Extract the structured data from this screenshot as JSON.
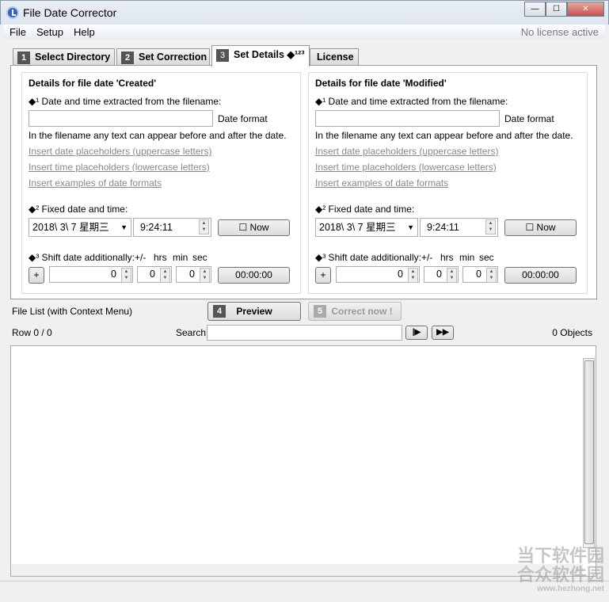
{
  "window": {
    "title": "File Date Corrector",
    "minimize": "—",
    "maximize": "☐",
    "close": "✕"
  },
  "menu": {
    "items": [
      "File",
      "Setup",
      "Help"
    ],
    "license_status": "No license active"
  },
  "tabs": [
    {
      "num": "1",
      "label": "Select Directory"
    },
    {
      "num": "2",
      "label": "Set Correction"
    },
    {
      "num": "3",
      "label": "Set Details ◆¹²³"
    },
    {
      "num": "",
      "label": "License"
    }
  ],
  "groups": [
    {
      "header": "Details for file date 'Created'",
      "extract_label": "◆¹ Date and time extracted from the filename:",
      "filename_value": "",
      "date_format_label": "Date format",
      "hint": "In the filename any text can appear before and after the date.",
      "link1": "Insert date placeholders (uppercase letters)",
      "link2": "Insert time placeholders (lowercase letters)",
      "link3": "Insert examples of date formats",
      "fixed_label": "◆² Fixed date and time:",
      "date_value": "2018\\  3\\  7 星期三",
      "time_value": "9:24:11",
      "now_label": "☐  Now",
      "shift_label": "◆³ Shift date additionally:",
      "col_sign": "+/-",
      "col_hrs": "hrs",
      "col_min": "min",
      "col_sec": "sec",
      "sign": "+",
      "hrs": "0",
      "min": "0",
      "sec": "0",
      "reset_label": "00:00:00"
    },
    {
      "header": "Details for file date 'Modified'",
      "extract_label": "◆¹ Date and time extracted from the filename:",
      "filename_value": "",
      "date_format_label": "Date format",
      "hint": "In the filename any text can appear before and after the date.",
      "link1": "Insert date placeholders (uppercase letters)",
      "link2": "Insert time placeholders (lowercase letters)",
      "link3": "Insert examples of date formats",
      "fixed_label": "◆² Fixed date and time:",
      "date_value": "2018\\  3\\  7 星期三",
      "time_value": "9:24:11",
      "now_label": "☐  Now",
      "shift_label": "◆³ Shift date additionally:",
      "col_sign": "+/-",
      "col_hrs": "hrs",
      "col_min": "min",
      "col_sec": "sec",
      "sign": "+",
      "hrs": "0",
      "min": "0",
      "sec": "0",
      "reset_label": "00:00:00"
    }
  ],
  "filelist": {
    "label": "File List (with Context Menu)",
    "preview_num": "4",
    "preview_label": "Preview",
    "correct_num": "5",
    "correct_label": "Correct now !",
    "row_label": "Row 0 / 0",
    "search_label": "Search",
    "search_value": "",
    "next_label": "|▶",
    "ff_label": "▶▶",
    "objects_label": "0 Objects"
  },
  "watermark": {
    "line1": "当下软件园",
    "line2": "合众软件园",
    "line3": "www.hezhong.net"
  }
}
